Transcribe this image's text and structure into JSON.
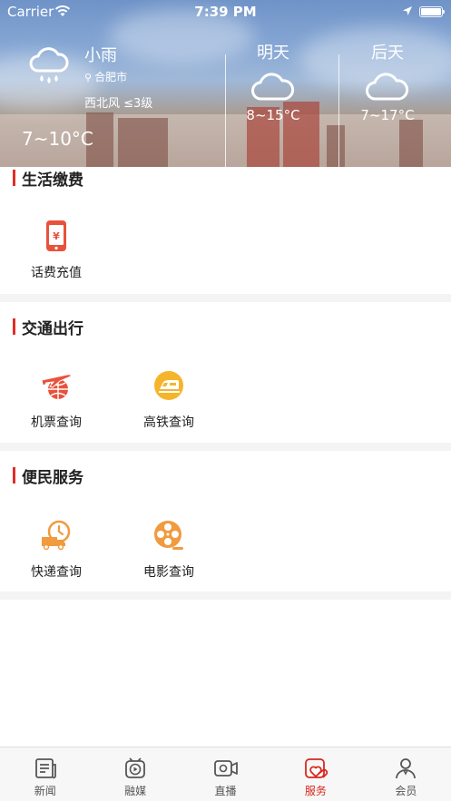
{
  "status_bar": {
    "carrier": "Carrier",
    "time": "7:39 PM"
  },
  "weather": {
    "today": {
      "condition": "小雨",
      "city": "合肥市",
      "wind": "西北风 ≤3级",
      "temp": "7~10°C",
      "icon": "rain-cloud-icon"
    },
    "tomorrow": {
      "label": "明天",
      "temp": "8~15°C",
      "icon": "cloud-icon"
    },
    "day_after": {
      "label": "后天",
      "temp": "7~17°C",
      "icon": "cloud-icon"
    }
  },
  "sections": [
    {
      "title": "生活缴费",
      "items": [
        {
          "label": "话费充值",
          "icon": "phone-recharge-icon"
        }
      ]
    },
    {
      "title": "交通出行",
      "items": [
        {
          "label": "机票查询",
          "icon": "airplane-globe-icon"
        },
        {
          "label": "高铁查询",
          "icon": "train-icon"
        }
      ]
    },
    {
      "title": "便民服务",
      "items": [
        {
          "label": "快递查询",
          "icon": "delivery-truck-clock-icon"
        },
        {
          "label": "电影查询",
          "icon": "film-reel-icon"
        }
      ]
    }
  ],
  "tabbar": {
    "active": "服务",
    "tabs": [
      {
        "label": "新闻",
        "icon": "news-icon"
      },
      {
        "label": "融媒",
        "icon": "media-play-icon"
      },
      {
        "label": "直播",
        "icon": "video-camera-icon"
      },
      {
        "label": "服务",
        "icon": "service-heart-icon"
      },
      {
        "label": "会员",
        "icon": "member-icon"
      }
    ]
  },
  "colors": {
    "accent": "#e02e24",
    "tab_active": "#d8281f",
    "icon_orange": "#f19a3e",
    "icon_red": "#e9523a",
    "icon_yellow": "#f6b42a"
  }
}
